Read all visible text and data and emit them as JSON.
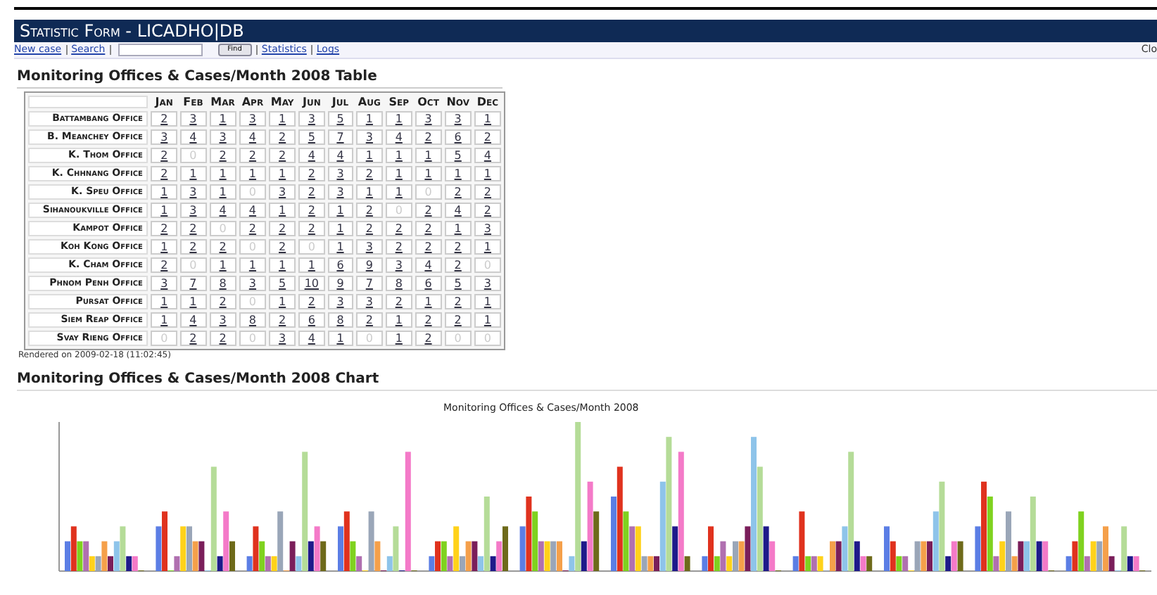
{
  "window": {
    "title": "Statistic Form - LICADHO|DB"
  },
  "nav": {
    "links_left": [
      "New case",
      "Search"
    ],
    "find_button": "Find",
    "links_right": [
      "Statistics",
      "Logs"
    ],
    "cut_text": "Clo"
  },
  "table_heading": "Monitoring Offices & Cases/Month 2008 Table",
  "table": {
    "columns": [
      "Jan",
      "Feb",
      "Mar",
      "Apr",
      "May",
      "Jun",
      "Jul",
      "Aug",
      "Sep",
      "Oct",
      "Nov",
      "Dec"
    ],
    "rows": [
      {
        "office": "Battambang Office",
        "counts": [
          "2",
          "3",
          "1",
          "3",
          "1",
          "3",
          "5",
          "1",
          "1",
          "3",
          "3",
          "1"
        ],
        "linked": [
          true,
          true,
          true,
          true,
          true,
          true,
          true,
          true,
          true,
          true,
          true,
          true
        ]
      },
      {
        "office": "B. Meanchey Office",
        "counts": [
          "3",
          "4",
          "3",
          "4",
          "2",
          "5",
          "7",
          "3",
          "4",
          "2",
          "6",
          "2"
        ],
        "linked": [
          true,
          true,
          true,
          true,
          true,
          true,
          true,
          true,
          true,
          true,
          true,
          true
        ]
      },
      {
        "office": "K. Thom Office",
        "counts": [
          "2",
          "0",
          "2",
          "2",
          "2",
          "4",
          "4",
          "1",
          "1",
          "1",
          "5",
          "4"
        ],
        "linked": [
          true,
          false,
          true,
          true,
          true,
          true,
          true,
          true,
          true,
          true,
          true,
          true
        ]
      },
      {
        "office": "K. Chhnang Office",
        "counts": [
          "2",
          "1",
          "1",
          "1",
          "1",
          "2",
          "3",
          "2",
          "1",
          "1",
          "1",
          "1"
        ],
        "linked": [
          true,
          true,
          true,
          true,
          true,
          true,
          true,
          true,
          true,
          true,
          true,
          true
        ]
      },
      {
        "office": "K. Speu Office",
        "counts": [
          "1",
          "3",
          "1",
          "0",
          "3",
          "2",
          "3",
          "1",
          "1",
          "0",
          "2",
          "2"
        ],
        "linked": [
          true,
          true,
          true,
          false,
          true,
          true,
          true,
          true,
          true,
          false,
          true,
          true
        ]
      },
      {
        "office": "Sihanoukville Office",
        "counts": [
          "1",
          "3",
          "4",
          "4",
          "1",
          "2",
          "1",
          "2",
          "0",
          "2",
          "4",
          "2"
        ],
        "linked": [
          true,
          true,
          true,
          true,
          true,
          true,
          true,
          true,
          false,
          true,
          true,
          true
        ]
      },
      {
        "office": "Kampot Office",
        "counts": [
          "2",
          "2",
          "0",
          "2",
          "2",
          "2",
          "1",
          "2",
          "2",
          "2",
          "1",
          "3"
        ],
        "linked": [
          true,
          true,
          false,
          true,
          true,
          true,
          true,
          true,
          true,
          true,
          true,
          true
        ]
      },
      {
        "office": "Koh Kong Office",
        "counts": [
          "1",
          "2",
          "2",
          "0",
          "2",
          "0",
          "1",
          "3",
          "2",
          "2",
          "2",
          "1"
        ],
        "linked": [
          true,
          true,
          true,
          false,
          true,
          false,
          true,
          true,
          true,
          true,
          true,
          true
        ]
      },
      {
        "office": "K. Cham Office",
        "counts": [
          "2",
          "0",
          "1",
          "1",
          "1",
          "1",
          "6",
          "9",
          "3",
          "4",
          "2",
          "0"
        ],
        "linked": [
          true,
          false,
          true,
          true,
          true,
          true,
          true,
          true,
          true,
          true,
          true,
          false
        ]
      },
      {
        "office": "Phnom Penh Office",
        "counts": [
          "3",
          "7",
          "8",
          "3",
          "5",
          "10",
          "9",
          "7",
          "8",
          "6",
          "5",
          "3"
        ],
        "linked": [
          true,
          true,
          true,
          true,
          true,
          true,
          true,
          true,
          true,
          true,
          true,
          true
        ]
      },
      {
        "office": "Pursat Office",
        "counts": [
          "1",
          "1",
          "2",
          "0",
          "1",
          "2",
          "3",
          "3",
          "2",
          "1",
          "2",
          "1"
        ],
        "linked": [
          true,
          true,
          true,
          false,
          true,
          true,
          true,
          true,
          true,
          true,
          true,
          true
        ]
      },
      {
        "office": "Siem Reap Office",
        "counts": [
          "1",
          "4",
          "3",
          "8",
          "2",
          "6",
          "8",
          "2",
          "1",
          "2",
          "2",
          "1"
        ],
        "linked": [
          true,
          true,
          true,
          true,
          true,
          true,
          true,
          true,
          true,
          true,
          true,
          true
        ]
      },
      {
        "office": "Svay Rieng Office",
        "counts": [
          "0",
          "2",
          "2",
          "0",
          "3",
          "4",
          "1",
          "0",
          "1",
          "2",
          "0",
          "0"
        ],
        "linked": [
          false,
          true,
          true,
          false,
          true,
          true,
          true,
          false,
          true,
          true,
          false,
          false
        ]
      }
    ]
  },
  "rendered_note": "Rendered on 2009-02-18 (11:02:45)",
  "chart_heading": "Monitoring Offices & Cases/Month 2008 Chart",
  "chart": {
    "title": "Monitoring Offices & Cases/Month 2008"
  }
}
